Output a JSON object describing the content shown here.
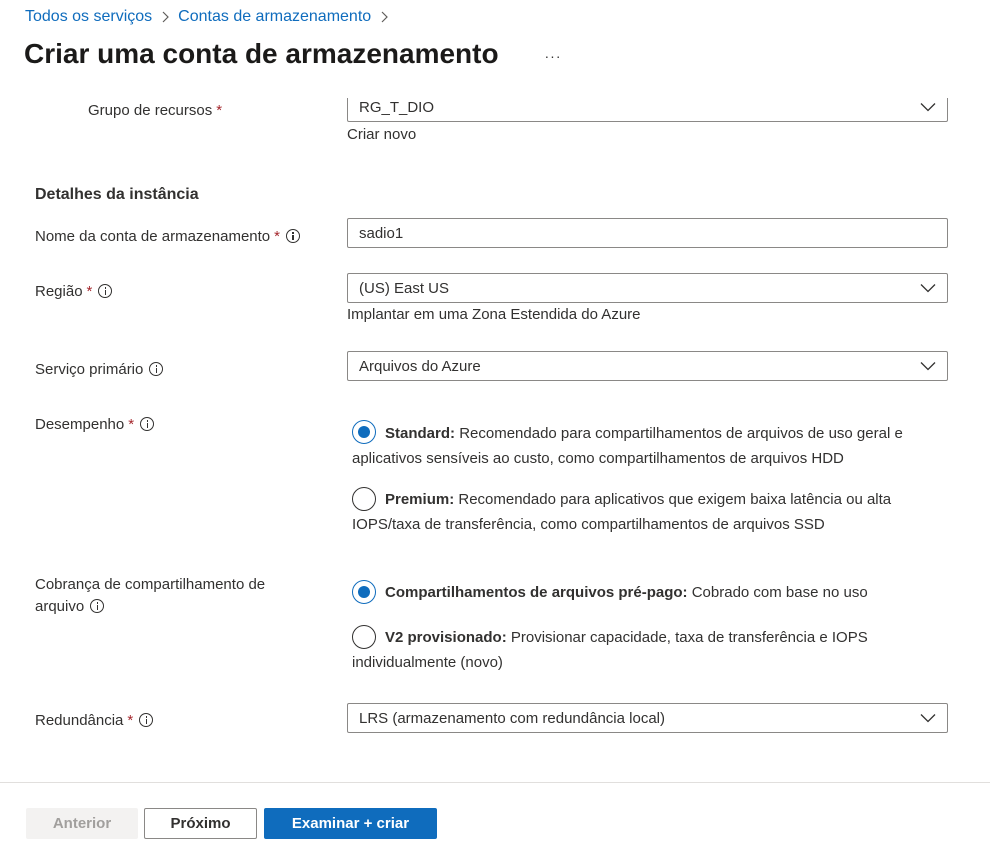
{
  "breadcrumb": {
    "items": [
      "Todos os serviços",
      "Contas de armazenamento"
    ]
  },
  "header": {
    "title": "Criar uma conta de armazenamento",
    "more": "···"
  },
  "form": {
    "resource_group": {
      "label": "Grupo de recursos",
      "value": "RG_T_DIO",
      "create_new": "Criar novo"
    },
    "instance_section_title": "Detalhes da instância",
    "storage_name": {
      "label": "Nome da conta de armazenamento",
      "value": "sadio1"
    },
    "region": {
      "label": "Região",
      "value": "(US) East US",
      "extended_zone_link": "Implantar em uma Zona Estendida do Azure"
    },
    "primary_service": {
      "label": "Serviço primário",
      "value": "Arquivos do Azure"
    },
    "performance": {
      "label": "Desempenho",
      "options": [
        {
          "title": "Standard:",
          "desc": "Recomendado para compartilhamentos de arquivos de uso geral e aplicativos sensíveis ao custo, como compartilhamentos de arquivos HDD",
          "selected": true
        },
        {
          "title": "Premium:",
          "desc": "Recomendado para aplicativos que exigem baixa latência ou alta IOPS/taxa de transferência, como compartilhamentos de arquivos SSD",
          "selected": false
        }
      ]
    },
    "billing": {
      "label_line1": "Cobrança de compartilhamento de",
      "label_line2": "arquivo",
      "options": [
        {
          "title": "Compartilhamentos de arquivos pré-pago:",
          "desc": "Cobrado com base no uso",
          "selected": true
        },
        {
          "title": "V2 provisionado:",
          "desc": "Provisionar capacidade, taxa de transferência e IOPS individualmente (novo)",
          "selected": false
        }
      ]
    },
    "redundancy": {
      "label": "Redundância",
      "value": "LRS (armazenamento com redundância local)"
    },
    "required_mark": "*"
  },
  "footer": {
    "prev": "Anterior",
    "next": "Próximo",
    "review": "Examinar + criar"
  },
  "colors": {
    "accent": "#0f6cbd",
    "required": "#a4262c",
    "text": "#323130"
  }
}
